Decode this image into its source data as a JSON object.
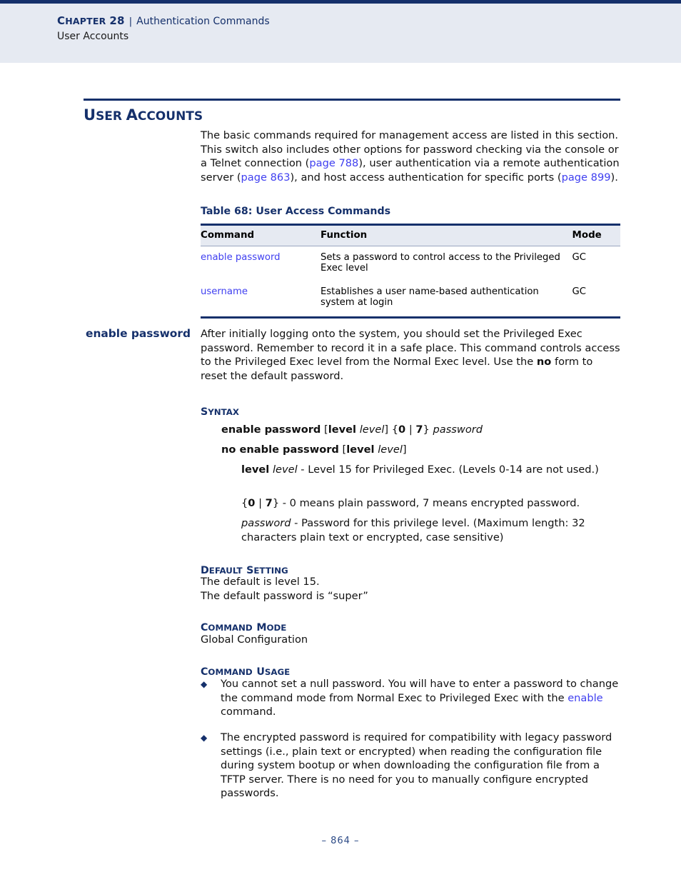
{
  "header": {
    "chapter_label": "CHAPTER 28",
    "separator": "|",
    "chapter_name": "Authentication Commands",
    "subtitle": "User Accounts"
  },
  "section": {
    "title": "USER ACCOUNTS",
    "intro_part1": "The basic commands required for management access are listed in this section. This switch also includes other options for password checking via the console or a Telnet connection (",
    "intro_link1": "page 788",
    "intro_part2": "), user authentication via a remote authentication server (",
    "intro_link2": "page 863",
    "intro_part3": "), and host access authentication for specific ports (",
    "intro_link3": "page 899",
    "intro_part4": ")."
  },
  "table": {
    "caption": "Table 68: User Access Commands",
    "columns": [
      "Command",
      "Function",
      "Mode"
    ],
    "rows": [
      {
        "command": "enable password",
        "function": "Sets a password to control access to the Privileged Exec level",
        "mode": "GC"
      },
      {
        "command": "username",
        "function": "Establishes a user name-based authentication system at login",
        "mode": "GC"
      }
    ]
  },
  "command": {
    "side_heading": "enable password",
    "description_part1": "After initially logging onto the system, you should set the Privileged Exec password. Remember to record it in a safe place. This command controls access to the Privileged Exec level from the Normal Exec level. Use the ",
    "description_bold": "no",
    "description_part2": " form to reset the default password.",
    "syntax_heading": "SYNTAX",
    "syntax_lines": [
      "enable password [level level] {0 | 7} password",
      "no enable password [level level]"
    ],
    "params": [
      "level level - Level 15 for Privileged Exec. (Levels 0-14 are not used.)",
      "{0 | 7} - 0 means plain password, 7 means encrypted password.",
      "password - Password for this privilege level. (Maximum length: 32 characters plain text or encrypted, case sensitive)"
    ],
    "default_heading": "DEFAULT SETTING",
    "default_line1": "The default is level 15.",
    "default_line2": "The default password is “super”",
    "mode_heading": "COMMAND MODE",
    "mode_value": "Global Configuration",
    "usage_heading": "COMMAND USAGE",
    "usage_bullets": [
      {
        "part1": "You cannot set a null password. You will have to enter a password to change the command mode from Normal Exec to Privileged Exec with the ",
        "link": "enable",
        "part2": " command."
      },
      {
        "part1": "The encrypted password is required for compatibility with legacy password settings (i.e., plain text or encrypted) when reading the configuration file during system bootup or when downloading the configuration file from a TFTP server. There is no need for you to manually configure encrypted passwords.",
        "link": "",
        "part2": ""
      }
    ],
    "bullet_glyph": "◆"
  },
  "footer": {
    "page_number": "–  864  –"
  },
  "colors": {
    "navy": "#15306b",
    "link_blue": "#3f3ff0",
    "header_band": "#e6eaf2"
  }
}
